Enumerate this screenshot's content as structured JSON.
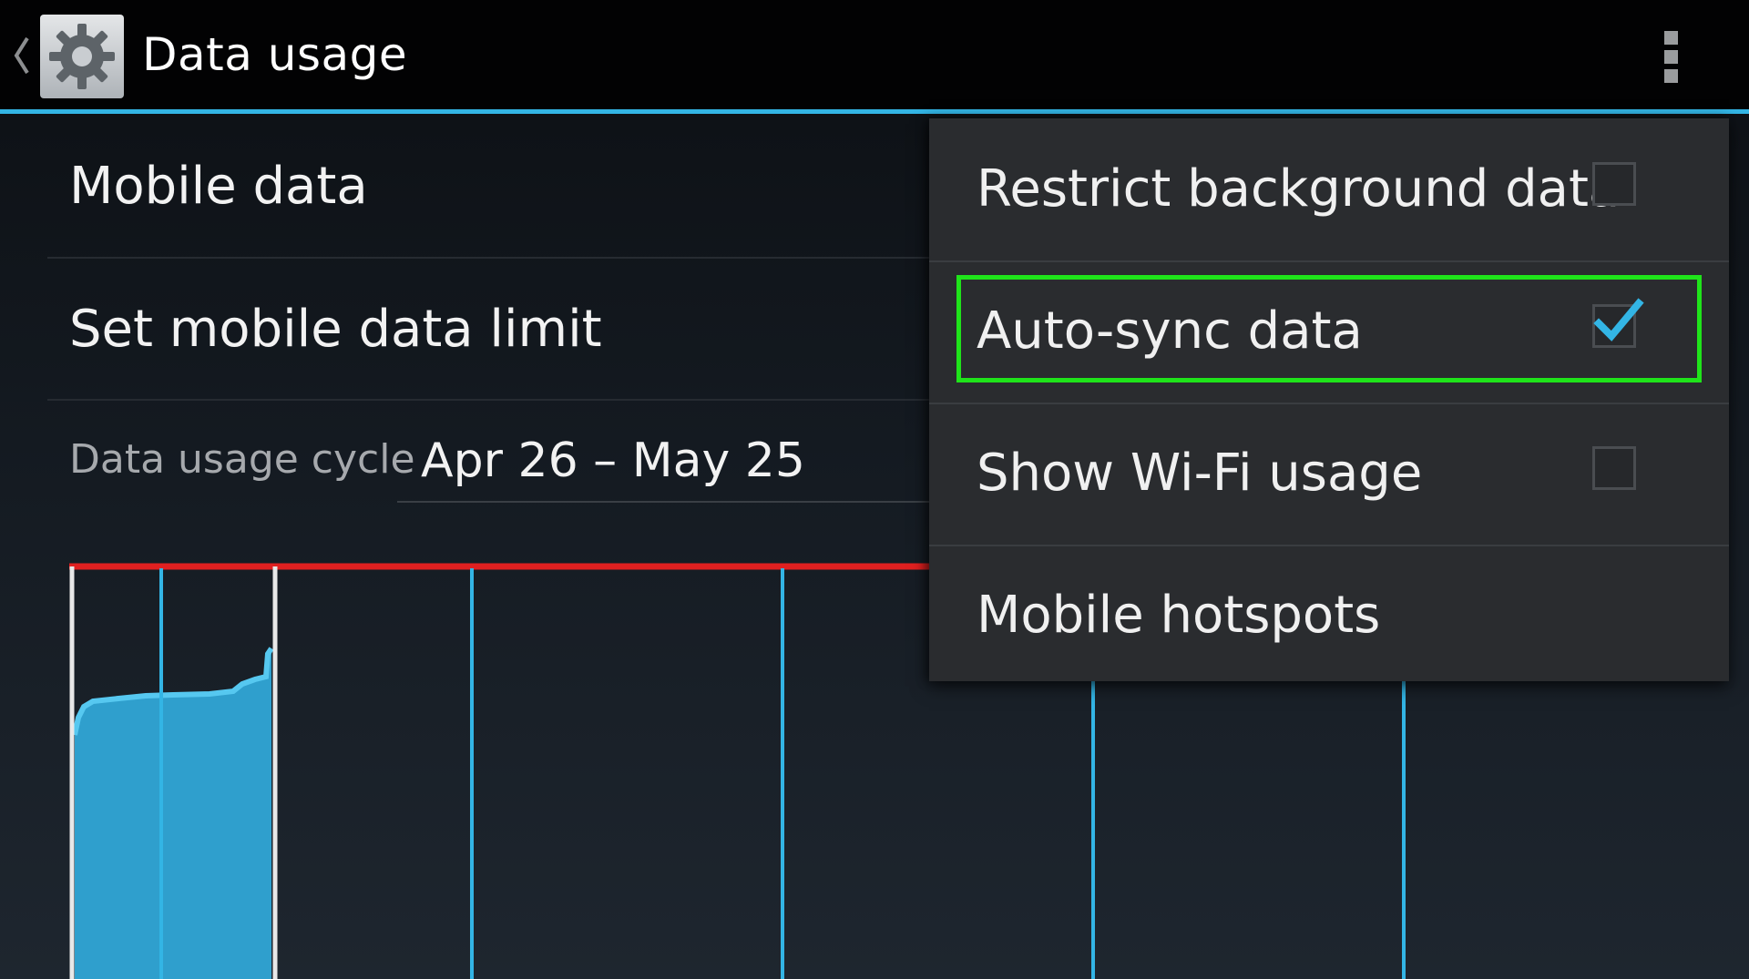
{
  "action_bar": {
    "title": "Data usage",
    "up_icon": "chevron-left-icon",
    "app_icon": "settings-gear-icon",
    "overflow_icon": "overflow-menu-icon",
    "accent_color": "#33b5e5"
  },
  "settings": {
    "mobile_data_label": "Mobile data",
    "set_limit_label": "Set mobile data limit",
    "cycle_label": "Data usage cycle",
    "cycle_value": "Apr 26 – May 25"
  },
  "menu": {
    "items": [
      {
        "label": "Restrict background data",
        "checkbox": true,
        "checked": false
      },
      {
        "label": "Auto-sync data",
        "checkbox": true,
        "checked": true,
        "highlighted": true
      },
      {
        "label": "Show Wi-Fi usage",
        "checkbox": true,
        "checked": false
      },
      {
        "label": "Mobile hotspots",
        "checkbox": false
      }
    ],
    "highlight_color": "#1fe41a"
  },
  "chart": {
    "limit_line_color": "#e02020",
    "series_color": "#33b5e5",
    "boundary_color": "#e8e8e8"
  }
}
